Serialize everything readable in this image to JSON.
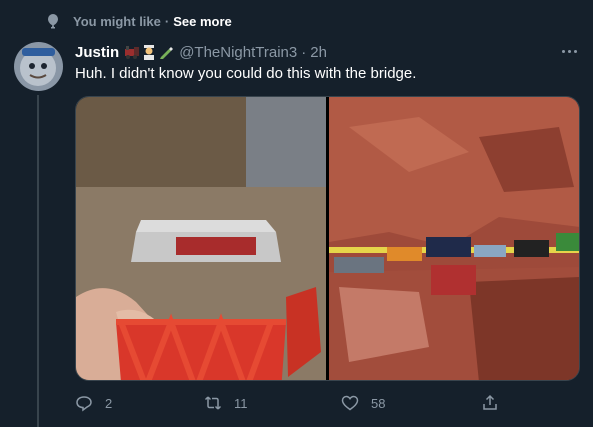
{
  "context": {
    "label": "You might like",
    "separator": "·",
    "link": "See more"
  },
  "tweet": {
    "name": "Justin",
    "handle": "@TheNightTrain3",
    "separator": "·",
    "time": "2h",
    "text": "Huh. I didn't know you could do this with the bridge.",
    "emoji": [
      "train-emoji",
      "person-emoji",
      "pencil-emoji"
    ]
  },
  "actions": {
    "replies": "2",
    "retweets": "11",
    "likes": "58"
  },
  "colors": {
    "background": "#15202b",
    "muted": "#8b98a5",
    "text": "#ffffff",
    "border": "#38444d"
  }
}
